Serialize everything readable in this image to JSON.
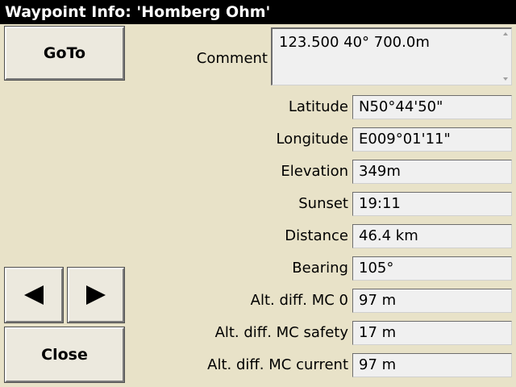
{
  "window": {
    "title": "Waypoint Info: 'Homberg Ohm'"
  },
  "buttons": {
    "goto_label": "GoTo",
    "prev_icon": "arrow-left-icon",
    "next_icon": "arrow-right-icon",
    "close_label": "Close"
  },
  "comment": {
    "label": "Comment",
    "value": "123.500 40° 700.0m"
  },
  "fields": [
    {
      "label": "Latitude",
      "value": "N50°44'50\""
    },
    {
      "label": "Longitude",
      "value": "E009°01'11\""
    },
    {
      "label": "Elevation",
      "value": "349m"
    },
    {
      "label": "Sunset",
      "value": "19:11"
    },
    {
      "label": "Distance",
      "value": "46.4 km"
    },
    {
      "label": "Bearing",
      "value": "105°"
    },
    {
      "label": "Alt. diff. MC 0",
      "value": "97 m"
    },
    {
      "label": "Alt. diff. MC safety",
      "value": "17 m"
    },
    {
      "label": "Alt. diff. MC current",
      "value": "97 m"
    }
  ],
  "colors": {
    "background": "#e8e2c8",
    "titlebar": "#000000",
    "field_bg": "#f0f0f0"
  }
}
